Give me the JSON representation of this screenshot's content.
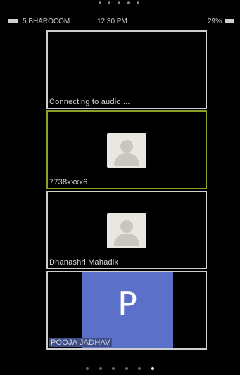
{
  "status_bar": {
    "carrier": "5 BHAROCOM",
    "time": "12:30 PM",
    "battery": "29%"
  },
  "participants": [
    {
      "label": "Connecting to audio ..."
    },
    {
      "label": "7738xxxx6"
    },
    {
      "label": "Dhanashri Mahadik"
    },
    {
      "label": "POOJA JADHAV",
      "avatar_letter": "P",
      "avatar_color": "#5b71c9"
    }
  ],
  "pager": {
    "pages": 6,
    "active_index": 5
  },
  "colors": {
    "active_border": "#8ea22a",
    "panel_border": "#cfcfcf"
  }
}
